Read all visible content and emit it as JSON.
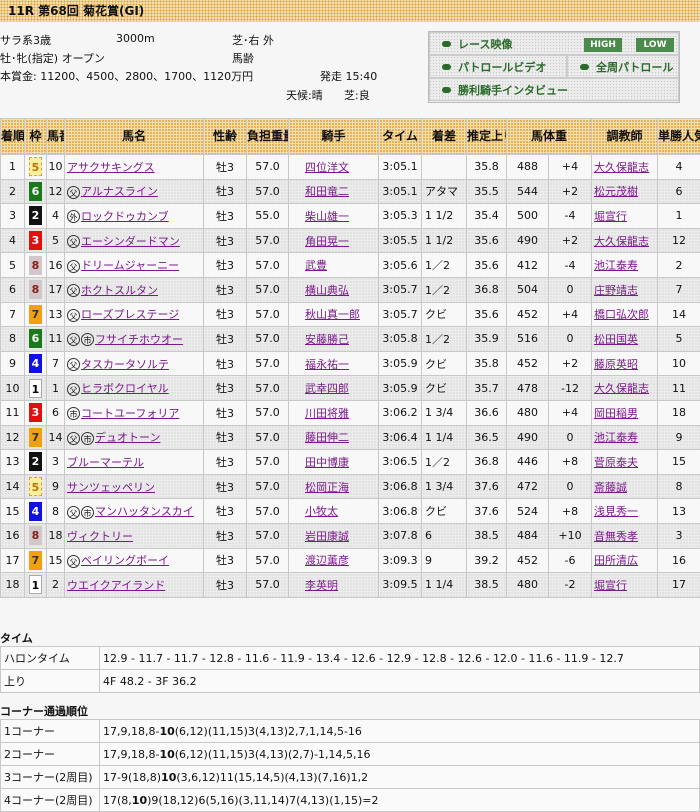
{
  "title": "11R 第68回 菊花賞(GI)",
  "info": {
    "class": "サラ系3歳",
    "distance": "3000m",
    "course": "芝･右 外",
    "condition": "牡･牝(指定) オープン",
    "weight_rule": "馬齢",
    "prize": "本賞金: 11200、4500、2800、1700、1120万円",
    "post_time": "発走 15:40",
    "weather": "天候:晴",
    "going": "芝:良"
  },
  "media": {
    "race_video": "レース映像",
    "high": "HIGH",
    "low": "LOW",
    "patrol": "パトロールビデオ",
    "full_patrol": "全周パトロール",
    "interview": "勝利騎手インタビュー"
  },
  "headers": [
    "着順",
    "枠",
    "馬番",
    "馬名",
    "性齢",
    "負担重量",
    "騎手",
    "タイム",
    "着差",
    "推定上り",
    "馬体重",
    "調教師",
    "単勝人気"
  ],
  "waku_colors": {
    "1": [
      "#ffffff",
      "#000"
    ],
    "2": [
      "#111111",
      "#fff"
    ],
    "3": [
      "#e01010",
      "#fff"
    ],
    "4": [
      "#1010e0",
      "#fff"
    ],
    "5": [
      "#f8f0a0",
      "#c07000"
    ],
    "6": [
      "#1a7a1a",
      "#fff"
    ],
    "7": [
      "#f0a010",
      "#333"
    ],
    "8": [
      "#d0c8c8",
      "#8a1a1a"
    ]
  },
  "rows": [
    {
      "pos": "1",
      "waku": "5",
      "num": "10",
      "marks": [],
      "horse": "アサクサキングス",
      "sa": "牡3",
      "wt": "57.0",
      "jockey": "四位洋文",
      "time": "3:05.1",
      "margin": "",
      "last": "35.8",
      "bw": "488",
      "diff": "+4",
      "trainer": "大久保龍志",
      "pop": "4"
    },
    {
      "pos": "2",
      "waku": "6",
      "num": "12",
      "marks": [
        "父"
      ],
      "horse": "アルナスライン",
      "sa": "牡3",
      "wt": "57.0",
      "jockey": "和田竜二",
      "time": "3:05.1",
      "margin": "アタマ",
      "last": "35.5",
      "bw": "544",
      "diff": "+2",
      "trainer": "松元茂樹",
      "pop": "6"
    },
    {
      "pos": "3",
      "waku": "2",
      "num": "4",
      "marks": [
        "外"
      ],
      "horse": "ロックドゥカンブ",
      "sa": "牡3",
      "wt": "55.0",
      "jockey": "柴山雄一",
      "time": "3:05.3",
      "margin": "1 1/2",
      "last": "35.4",
      "bw": "500",
      "diff": "-4",
      "trainer": "堀宣行",
      "pop": "1"
    },
    {
      "pos": "4",
      "waku": "3",
      "num": "5",
      "marks": [
        "父"
      ],
      "horse": "エーシンダードマン",
      "sa": "牡3",
      "wt": "57.0",
      "jockey": "角田晃一",
      "time": "3:05.5",
      "margin": "1 1/2",
      "last": "35.6",
      "bw": "490",
      "diff": "+2",
      "trainer": "大久保龍志",
      "pop": "12"
    },
    {
      "pos": "5",
      "waku": "8",
      "num": "16",
      "marks": [
        "父"
      ],
      "horse": "ドリームジャーニー",
      "sa": "牡3",
      "wt": "57.0",
      "jockey": "武豊",
      "time": "3:05.6",
      "margin": "1／2",
      "last": "35.6",
      "bw": "412",
      "diff": "-4",
      "trainer": "池江泰寿",
      "pop": "2"
    },
    {
      "pos": "6",
      "waku": "8",
      "num": "17",
      "marks": [
        "父"
      ],
      "horse": "ホクトスルタン",
      "sa": "牡3",
      "wt": "57.0",
      "jockey": "横山典弘",
      "time": "3:05.7",
      "margin": "1／2",
      "last": "36.8",
      "bw": "504",
      "diff": "0",
      "trainer": "庄野靖志",
      "pop": "7"
    },
    {
      "pos": "7",
      "waku": "7",
      "num": "13",
      "marks": [
        "父"
      ],
      "horse": "ローズプレステージ",
      "sa": "牡3",
      "wt": "57.0",
      "jockey": "秋山真一郎",
      "time": "3:05.7",
      "margin": "クビ",
      "last": "35.6",
      "bw": "452",
      "diff": "+4",
      "trainer": "橋口弘次郎",
      "pop": "14"
    },
    {
      "pos": "8",
      "waku": "6",
      "num": "11",
      "marks": [
        "父",
        "市"
      ],
      "horse": "フサイチホウオー",
      "sa": "牡3",
      "wt": "57.0",
      "jockey": "安藤勝己",
      "time": "3:05.8",
      "margin": "1／2",
      "last": "35.9",
      "bw": "516",
      "diff": "0",
      "trainer": "松田国英",
      "pop": "5"
    },
    {
      "pos": "9",
      "waku": "4",
      "num": "7",
      "marks": [
        "父"
      ],
      "horse": "タスカータソルテ",
      "sa": "牡3",
      "wt": "57.0",
      "jockey": "福永祐一",
      "time": "3:05.9",
      "margin": "クビ",
      "last": "35.8",
      "bw": "452",
      "diff": "+2",
      "trainer": "藤原英昭",
      "pop": "10"
    },
    {
      "pos": "10",
      "waku": "1",
      "num": "1",
      "marks": [
        "父"
      ],
      "horse": "ヒラボクロイヤル",
      "sa": "牡3",
      "wt": "57.0",
      "jockey": "武幸四郎",
      "time": "3:05.9",
      "margin": "クビ",
      "last": "35.7",
      "bw": "478",
      "diff": "-12",
      "trainer": "大久保龍志",
      "pop": "11"
    },
    {
      "pos": "11",
      "waku": "3",
      "num": "6",
      "marks": [
        "市"
      ],
      "horse": "コートユーフォリア",
      "sa": "牡3",
      "wt": "57.0",
      "jockey": "川田将雅",
      "time": "3:06.2",
      "margin": "1 3/4",
      "last": "36.6",
      "bw": "480",
      "diff": "+4",
      "trainer": "岡田稲男",
      "pop": "18"
    },
    {
      "pos": "12",
      "waku": "7",
      "num": "14",
      "marks": [
        "父",
        "市"
      ],
      "horse": "デュオトーン",
      "sa": "牡3",
      "wt": "57.0",
      "jockey": "藤田伸二",
      "time": "3:06.4",
      "margin": "1 1/4",
      "last": "36.5",
      "bw": "490",
      "diff": "0",
      "trainer": "池江泰寿",
      "pop": "9"
    },
    {
      "pos": "13",
      "waku": "2",
      "num": "3",
      "marks": [],
      "horse": "ブルーマーテル",
      "sa": "牡3",
      "wt": "57.0",
      "jockey": "田中博康",
      "time": "3:06.5",
      "margin": "1／2",
      "last": "36.8",
      "bw": "446",
      "diff": "+8",
      "trainer": "菅原泰夫",
      "pop": "15"
    },
    {
      "pos": "14",
      "waku": "5",
      "num": "9",
      "marks": [],
      "horse": "サンツェッペリン",
      "sa": "牡3",
      "wt": "57.0",
      "jockey": "松岡正海",
      "time": "3:06.8",
      "margin": "1 3/4",
      "last": "37.6",
      "bw": "472",
      "diff": "0",
      "trainer": "斎藤誠",
      "pop": "8"
    },
    {
      "pos": "15",
      "waku": "4",
      "num": "8",
      "marks": [
        "父",
        "市"
      ],
      "horse": "マンハッタンスカイ",
      "sa": "牡3",
      "wt": "57.0",
      "jockey": "小牧太",
      "time": "3:06.8",
      "margin": "クビ",
      "last": "37.6",
      "bw": "524",
      "diff": "+8",
      "trainer": "浅見秀一",
      "pop": "13"
    },
    {
      "pos": "16",
      "waku": "8",
      "num": "18",
      "marks": [],
      "horse": "ヴィクトリー",
      "sa": "牡3",
      "wt": "57.0",
      "jockey": "岩田康誠",
      "time": "3:07.8",
      "margin": "6",
      "last": "38.5",
      "bw": "484",
      "diff": "+10",
      "trainer": "音無秀孝",
      "pop": "3"
    },
    {
      "pos": "17",
      "waku": "7",
      "num": "15",
      "marks": [
        "父"
      ],
      "horse": "ベイリングボーイ",
      "sa": "牡3",
      "wt": "57.0",
      "jockey": "渡辺薫彦",
      "time": "3:09.3",
      "margin": "9",
      "last": "39.2",
      "bw": "452",
      "diff": "-6",
      "trainer": "田所清広",
      "pop": "16"
    },
    {
      "pos": "18",
      "waku": "1",
      "num": "2",
      "marks": [],
      "horse": "ウエイクアイランド",
      "sa": "牡3",
      "wt": "57.0",
      "jockey": "李英明",
      "time": "3:09.5",
      "margin": "1 1/4",
      "last": "38.5",
      "bw": "480",
      "diff": "-2",
      "trainer": "堀宣行",
      "pop": "17"
    }
  ],
  "time_section": {
    "heading": "タイム",
    "furlong_label": "ハロンタイム",
    "furlong": "12.9 - 11.7 - 11.7 - 12.8 - 11.6 - 11.9 - 13.4 - 12.6 - 12.9 - 12.8 - 12.6 - 12.0 - 11.6 - 11.9 - 12.7",
    "last_label": "上り",
    "last": "4F 48.2 - 3F 36.2"
  },
  "corner_section": {
    "heading": "コーナー通過順位",
    "rows": [
      {
        "label": "1コーナー",
        "pre": "17,9,18,8-",
        "bold": "10",
        "post": "(6,12)(11,15)3(4,13)2,7,1,14,5-16"
      },
      {
        "label": "2コーナー",
        "pre": "17,9,18,8-",
        "bold": "10",
        "post": "(6,12)(11,15)3(4,13)(2,7)-1,14,5,16"
      },
      {
        "label": "3コーナー(2周目)",
        "pre": "17-9(18,8)",
        "bold": "10",
        "post": "(3,6,12)11(15,14,5)(4,13)(7,16)1,2"
      },
      {
        "label": "4コーナー(2周目)",
        "pre": "17(8,",
        "bold": "10",
        "post": ")9(18,12)6(5,16)(3,11,14)7(4,13)(1,15)=2"
      }
    ]
  }
}
